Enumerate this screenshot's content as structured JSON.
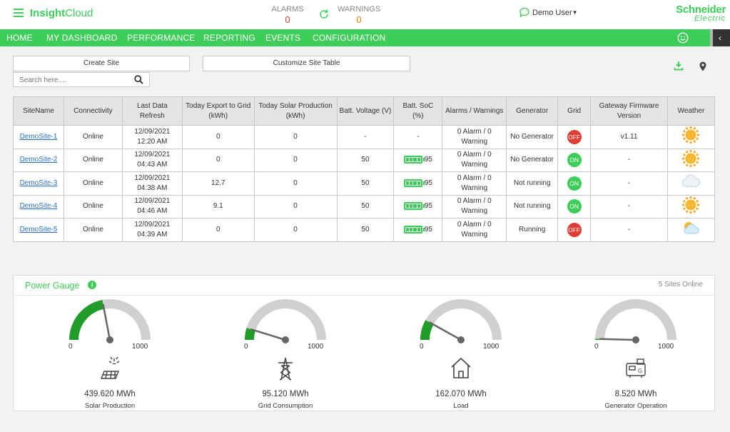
{
  "header": {
    "brand_bold": "Insight",
    "brand_light": "Cloud",
    "alarms_label": "ALARMS",
    "alarms_value": "0",
    "warnings_label": "WARNINGS",
    "warnings_value": "0",
    "user_name": "Demo User",
    "logo_line1": "Schneider",
    "logo_line2": "Electric"
  },
  "nav": {
    "items": [
      "HOME",
      "MY DASHBOARD",
      "PERFORMANCE",
      "REPORTING",
      "EVENTS",
      "CONFIGURATION"
    ]
  },
  "toolbar": {
    "create_site": "Create Site",
    "customize_table": "Customize Site Table",
    "search_placeholder": "Search here...."
  },
  "table": {
    "headers": [
      "SiteName",
      "Connectivity",
      "Last Data Refresh",
      "Today Export to Grid (kWh)",
      "Today Solar Production (kWh)",
      "Batt. Voltage (V)",
      "Batt. SoC (%)",
      "Alarms / Warnings",
      "Generator",
      "Grid",
      "Gateway Firmware Version",
      "Weather"
    ],
    "rows": [
      {
        "name": "DemoSite-1",
        "conn": "Online",
        "date": "12/09/2021",
        "time": "12:20 AM",
        "export": "0",
        "solar": "0",
        "voltage": "-",
        "soc": "-",
        "has_batt": false,
        "alarms": "0 Alarm / 0",
        "warnings": "Warning",
        "generator": "No Generator",
        "grid": "OFF",
        "firmware": "v1.11",
        "weather": "sunny-icon"
      },
      {
        "name": "DemoSite-2",
        "conn": "Online",
        "date": "12/09/2021",
        "time": "04:43 AM",
        "export": "0",
        "solar": "0",
        "voltage": "50",
        "soc": "95",
        "has_batt": true,
        "alarms": "0 Alarm / 0",
        "warnings": "Warning",
        "generator": "No Generator",
        "grid": "ON",
        "firmware": "-",
        "weather": "sunny-icon"
      },
      {
        "name": "DemoSite-3",
        "conn": "Online",
        "date": "12/09/2021",
        "time": "04:38 AM",
        "export": "12.7",
        "solar": "0",
        "voltage": "50",
        "soc": "95",
        "has_batt": true,
        "alarms": "0 Alarm / 0",
        "warnings": "Warning",
        "generator": "Not running",
        "grid": "ON",
        "firmware": "-",
        "weather": "cloudy-icon"
      },
      {
        "name": "DemoSite-4",
        "conn": "Online",
        "date": "12/09/2021",
        "time": "04:46 AM",
        "export": "9.1",
        "solar": "0",
        "voltage": "50",
        "soc": "95",
        "has_batt": true,
        "alarms": "0 Alarm / 0",
        "warnings": "Warning",
        "generator": "Not running",
        "grid": "ON",
        "firmware": "-",
        "weather": "sunny-icon"
      },
      {
        "name": "DemoSite-5",
        "conn": "Online",
        "date": "12/09/2021",
        "time": "04:39 AM",
        "export": "0",
        "solar": "0",
        "voltage": "50",
        "soc": "95",
        "has_batt": true,
        "alarms": "0 Alarm / 0",
        "warnings": "Warning",
        "generator": "Running",
        "grid": "OFF",
        "firmware": "-",
        "weather": "partly-cloudy-icon"
      }
    ]
  },
  "power_gauge": {
    "title": "Power Gauge",
    "status": "5 Sites Online",
    "gauges": [
      {
        "label": "Solar Production",
        "value": "439.620 MWh",
        "min": "0",
        "max": "1000",
        "fraction": 0.44,
        "icon": "solar-panel-icon"
      },
      {
        "label": "Grid Consumption",
        "value": "95.120 MWh",
        "min": "0",
        "max": "1000",
        "fraction": 0.095,
        "icon": "grid-tower-icon"
      },
      {
        "label": "Load",
        "value": "162.070 MWh",
        "min": "0",
        "max": "1000",
        "fraction": 0.162,
        "icon": "house-icon"
      },
      {
        "label": "Generator Operation",
        "value": "8.520 MWh",
        "min": "0",
        "max": "1000",
        "fraction": 0.0085,
        "icon": "generator-icon"
      }
    ]
  },
  "colors": {
    "brand_green": "#3dcd58",
    "gauge_fill": "#219c2b",
    "gauge_track": "#d0d0d0",
    "alarm_red": "#e03c31",
    "warning_orange": "#e47f00"
  }
}
